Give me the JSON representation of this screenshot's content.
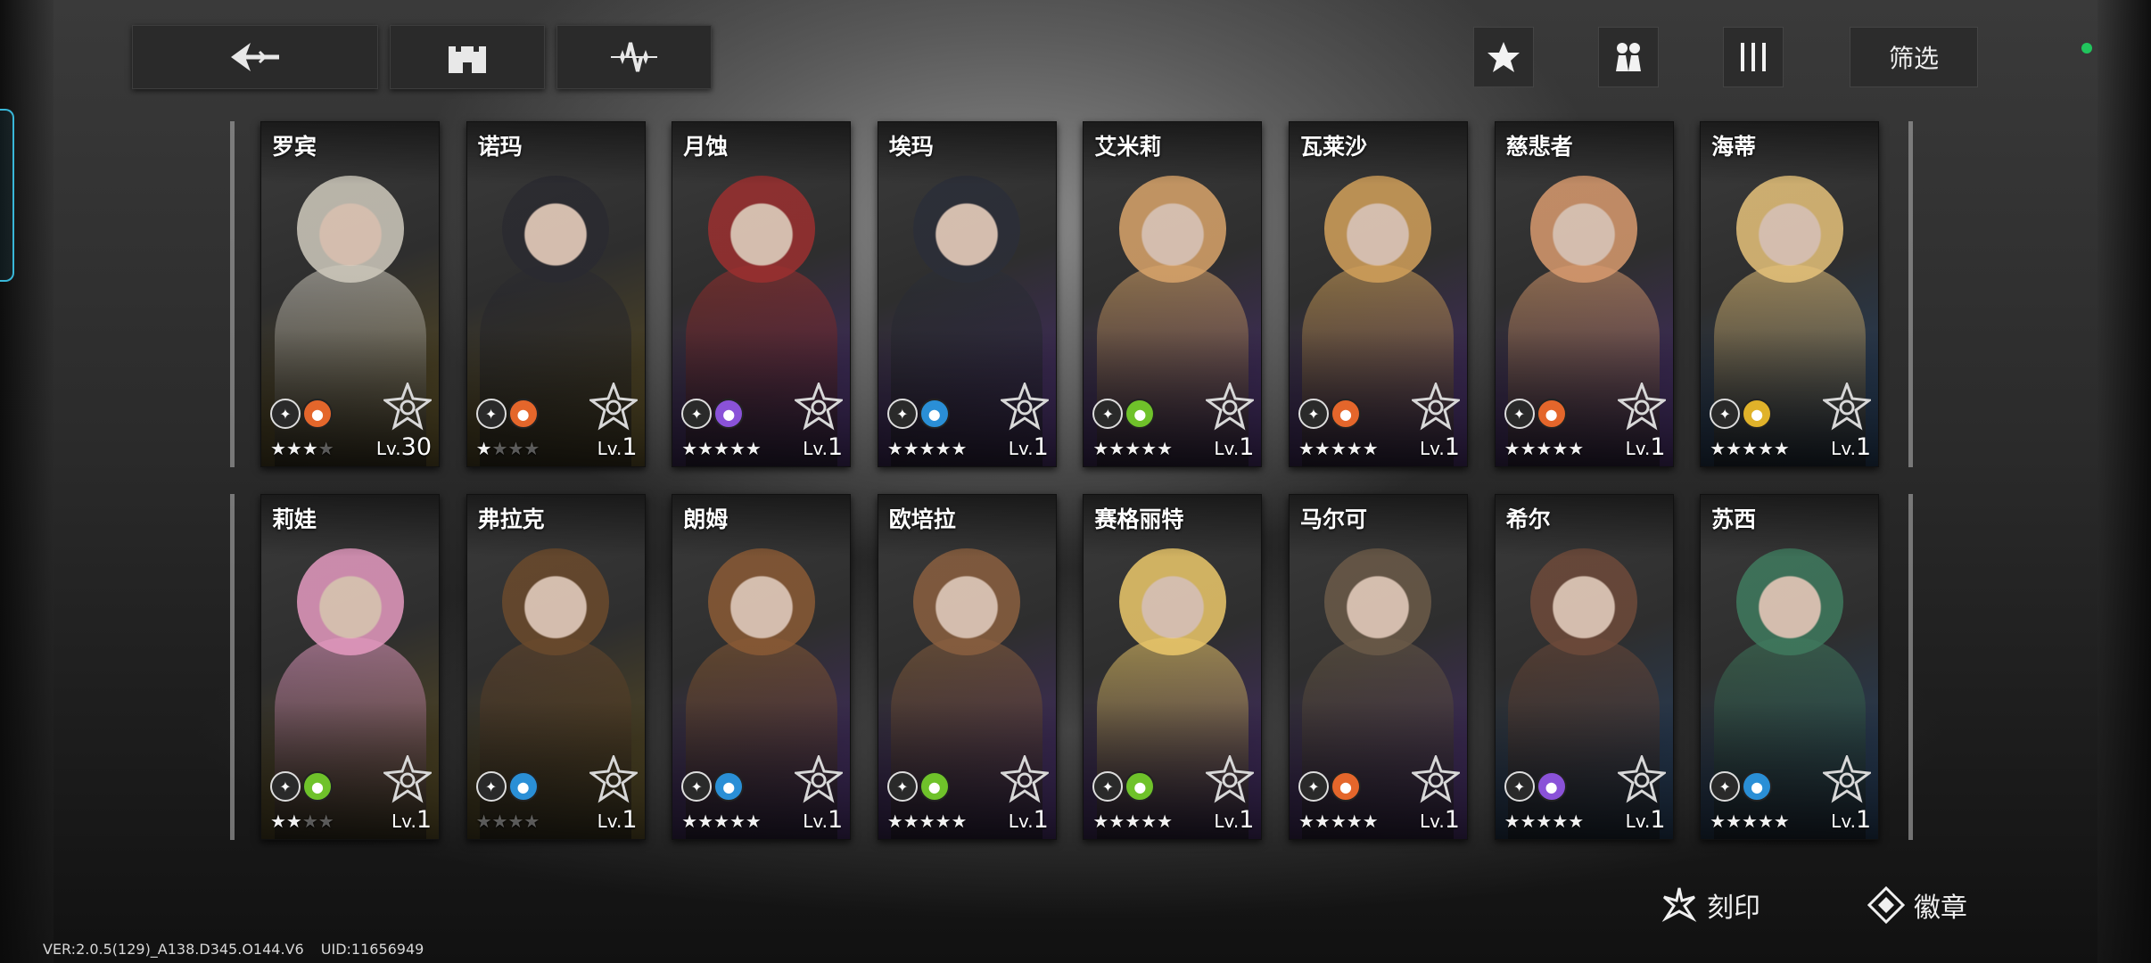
{
  "topbar": {
    "back_icon": "back-arrow-icon",
    "base_icon": "castle-icon",
    "formation_icon": "spark-icon",
    "favorite_icon": "star-icon",
    "group_icon": "group-icon",
    "sort_icon": "bars-icon",
    "filter_label": "筛选"
  },
  "colors": {
    "accent": "#39b7d8",
    "status_dot": "#21c55d",
    "element_fire": "#e4662b",
    "element_water": "#2a8fd6",
    "element_void": "#8a52d8",
    "element_wind": "#6fc22a",
    "element_light": "#e0b22a"
  },
  "characters": [
    {
      "name": "罗宾",
      "stars_on": "★★★",
      "stars_off": "★",
      "lv_prefix": "Lv.",
      "level": "30",
      "rarity": "gold",
      "class_icon": "crest-icon",
      "element": "fire-icon",
      "element_color": "#e4662b"
    },
    {
      "name": "诺玛",
      "stars_on": "★",
      "stars_off": "★★★",
      "lv_prefix": "Lv.",
      "level": "1",
      "rarity": "gold",
      "class_icon": "sword-icon",
      "element": "fire-icon",
      "element_color": "#e4662b"
    },
    {
      "name": "月蚀",
      "stars_on": "★★★★★",
      "stars_off": "",
      "lv_prefix": "Lv.",
      "level": "1",
      "rarity": "purple",
      "class_icon": "sword-icon",
      "element": "void-icon",
      "element_color": "#8a52d8"
    },
    {
      "name": "埃玛",
      "stars_on": "★★★★★",
      "stars_off": "",
      "lv_prefix": "Lv.",
      "level": "1",
      "rarity": "purple",
      "class_icon": "crest-icon",
      "element": "water-icon",
      "element_color": "#2a8fd6"
    },
    {
      "name": "艾米莉",
      "stars_on": "★★★★★",
      "stars_off": "",
      "lv_prefix": "Lv.",
      "level": "1",
      "rarity": "purple",
      "class_icon": "sword-icon",
      "element": "wind-icon",
      "element_color": "#6fc22a"
    },
    {
      "name": "瓦莱沙",
      "stars_on": "★★★★★",
      "stars_off": "",
      "lv_prefix": "Lv.",
      "level": "1",
      "rarity": "purple",
      "class_icon": "wing-icon",
      "element": "fire-icon",
      "element_color": "#e4662b"
    },
    {
      "name": "慈悲者",
      "stars_on": "★★★★★",
      "stars_off": "",
      "lv_prefix": "Lv.",
      "level": "1",
      "rarity": "purple",
      "class_icon": "crest-icon",
      "element": "fire-icon",
      "element_color": "#e4662b"
    },
    {
      "name": "海蒂",
      "stars_on": "★★★★★",
      "stars_off": "",
      "lv_prefix": "Lv.",
      "level": "1",
      "rarity": "blue",
      "class_icon": "sword-icon",
      "element": "light-icon",
      "element_color": "#e0b22a"
    },
    {
      "name": "莉娃",
      "stars_on": "★★",
      "stars_off": "★★",
      "lv_prefix": "Lv.",
      "level": "1",
      "rarity": "gold",
      "class_icon": "flower-icon",
      "element": "wind-icon",
      "element_color": "#6fc22a"
    },
    {
      "name": "弗拉克",
      "stars_on": "",
      "stars_off": "★★★★",
      "lv_prefix": "Lv.",
      "level": "1",
      "rarity": "gold",
      "class_icon": "wing-icon",
      "element": "water-icon",
      "element_color": "#2a8fd6"
    },
    {
      "name": "朗姆",
      "stars_on": "★★★★★",
      "stars_off": "",
      "lv_prefix": "Lv.",
      "level": "1",
      "rarity": "purple",
      "class_icon": "sword-icon",
      "element": "water-icon",
      "element_color": "#2a8fd6"
    },
    {
      "name": "欧培拉",
      "stars_on": "★★★★★",
      "stars_off": "",
      "lv_prefix": "Lv.",
      "level": "1",
      "rarity": "purple",
      "class_icon": "wing-icon",
      "element": "wind-icon",
      "element_color": "#6fc22a"
    },
    {
      "name": "赛格丽特",
      "stars_on": "★★★★★",
      "stars_off": "",
      "lv_prefix": "Lv.",
      "level": "1",
      "rarity": "purple",
      "class_icon": "crest-icon",
      "element": "wind-icon",
      "element_color": "#6fc22a"
    },
    {
      "name": "马尔可",
      "stars_on": "★★★★★",
      "stars_off": "",
      "lv_prefix": "Lv.",
      "level": "1",
      "rarity": "purple",
      "class_icon": "flower-icon",
      "element": "fire-icon",
      "element_color": "#e4662b"
    },
    {
      "name": "希尔",
      "stars_on": "★★★★★",
      "stars_off": "",
      "lv_prefix": "Lv.",
      "level": "1",
      "rarity": "blue",
      "class_icon": "wing-icon",
      "element": "void-icon",
      "element_color": "#8a52d8"
    },
    {
      "name": "苏西",
      "stars_on": "★★★★★",
      "stars_off": "",
      "lv_prefix": "Lv.",
      "level": "1",
      "rarity": "blue",
      "class_icon": "flower-icon",
      "element": "water-icon",
      "element_color": "#2a8fd6"
    }
  ],
  "bottom": {
    "imprint_label": "刻印",
    "badge_label": "徽章"
  },
  "footer": {
    "version": "VER:2.0.5(129)_A138.D345.O144.V6",
    "uid": "UID:11656949"
  }
}
